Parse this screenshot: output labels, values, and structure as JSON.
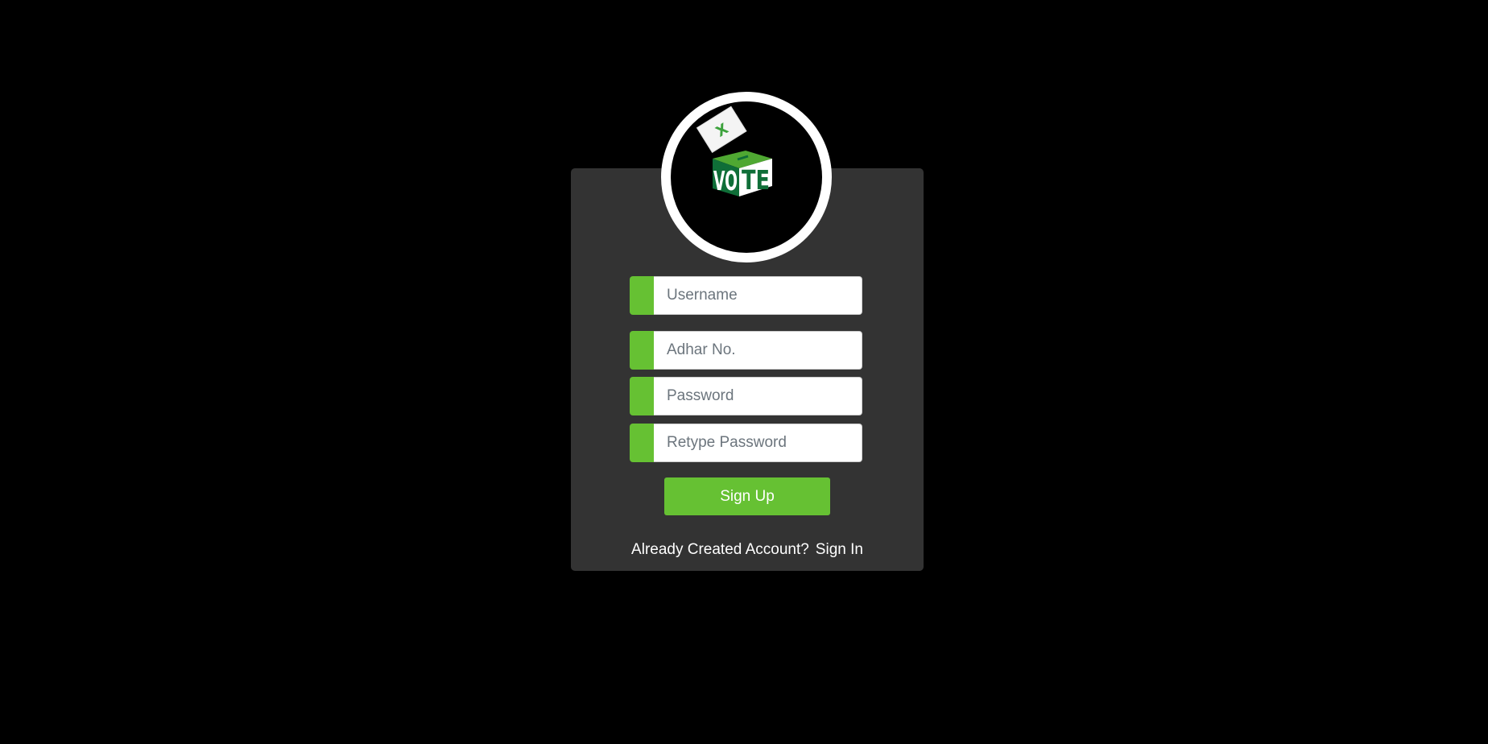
{
  "logo": {
    "box_text": "VOTE",
    "ballot_mark": "X",
    "icon": "ballot-box-icon",
    "colors": {
      "dark_green": "#0f6e38",
      "light_green": "#4fa832",
      "ballot_mark": "#3ca23c"
    }
  },
  "form": {
    "username_placeholder": "Username",
    "adhar_placeholder": "Adhar No.",
    "password_placeholder": "Password",
    "retype_password_placeholder": "Retype Password",
    "submit_label": "Sign Up"
  },
  "footer": {
    "prompt_text": "Already Created Account?",
    "signin_label": "Sign In"
  },
  "colors": {
    "background": "#000000",
    "card": "#333333",
    "accent": "#66c133",
    "text": "#ffffff"
  }
}
